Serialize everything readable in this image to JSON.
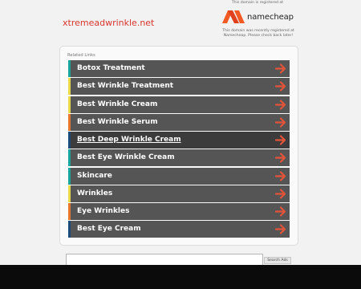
{
  "domain": "xtremeadwrinkle.net",
  "registrar": {
    "top_text": "This domain is registered at",
    "logo_text": "namecheap",
    "note": "This domain was recently registered at Namecheap. Please check back later!"
  },
  "related": {
    "title": "Related Links",
    "links": [
      {
        "label": "Botox Treatment",
        "color": "#1aa59c"
      },
      {
        "label": "Best Wrinkle Treatment",
        "color": "#e8d84a"
      },
      {
        "label": "Best Wrinkle Cream",
        "color": "#e8d84a"
      },
      {
        "label": "Best Wrinkle Serum",
        "color": "#e8772e"
      },
      {
        "label": "Best Deep Wrinkle Cream",
        "color": "#1b4b7a"
      },
      {
        "label": "Best Eye Wrinkle Cream",
        "color": "#1aa59c"
      },
      {
        "label": "Skincare",
        "color": "#1aa59c"
      },
      {
        "label": "Wrinkles",
        "color": "#e8d84a"
      },
      {
        "label": "Eye Wrinkles",
        "color": "#e8772e"
      },
      {
        "label": "Best Eye Cream",
        "color": "#1b4b7a"
      }
    ],
    "arrow_color": "#e2543a",
    "active_index": 4
  },
  "search": {
    "button_label": "Search Ads"
  }
}
